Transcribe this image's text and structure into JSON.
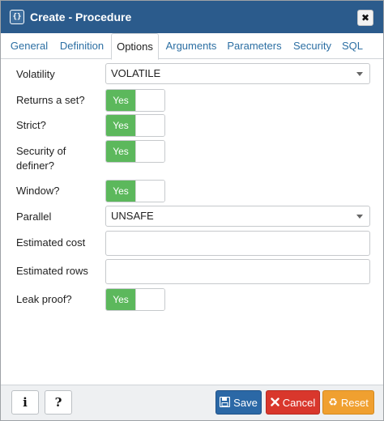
{
  "window": {
    "title": "Create - Procedure",
    "title_icon": "{}",
    "close_glyph": "✖"
  },
  "tabs": [
    {
      "label": "General",
      "active": false
    },
    {
      "label": "Definition",
      "active": false
    },
    {
      "label": "Options",
      "active": true
    },
    {
      "label": "Arguments",
      "active": false
    },
    {
      "label": "Parameters",
      "active": false
    },
    {
      "label": "Security",
      "active": false
    },
    {
      "label": "SQL",
      "active": false
    }
  ],
  "form": {
    "volatility": {
      "label": "Volatility",
      "value": "VOLATILE"
    },
    "returns_set": {
      "label": "Returns a set?",
      "value": "Yes"
    },
    "strict": {
      "label": "Strict?",
      "value": "Yes"
    },
    "security_definer": {
      "label_line1": "Security of",
      "label_line2": "definer?",
      "value": "Yes"
    },
    "window": {
      "label": "Window?",
      "value": "Yes"
    },
    "parallel": {
      "label": "Parallel",
      "value": "UNSAFE"
    },
    "estimated_cost": {
      "label": "Estimated cost",
      "value": ""
    },
    "estimated_rows": {
      "label": "Estimated rows",
      "value": ""
    },
    "leak_proof": {
      "label": "Leak proof?",
      "value": "Yes"
    }
  },
  "footer": {
    "info_label": "i",
    "help_label": "?",
    "save_label": "Save",
    "cancel_label": "Cancel",
    "reset_label": "Reset"
  },
  "colors": {
    "titlebar": "#2b5b8c",
    "toggle_on": "#5cb85c",
    "save": "#2b68a6",
    "cancel": "#d9372c",
    "reset": "#f0a030",
    "tab_link": "#2c6fa3"
  }
}
